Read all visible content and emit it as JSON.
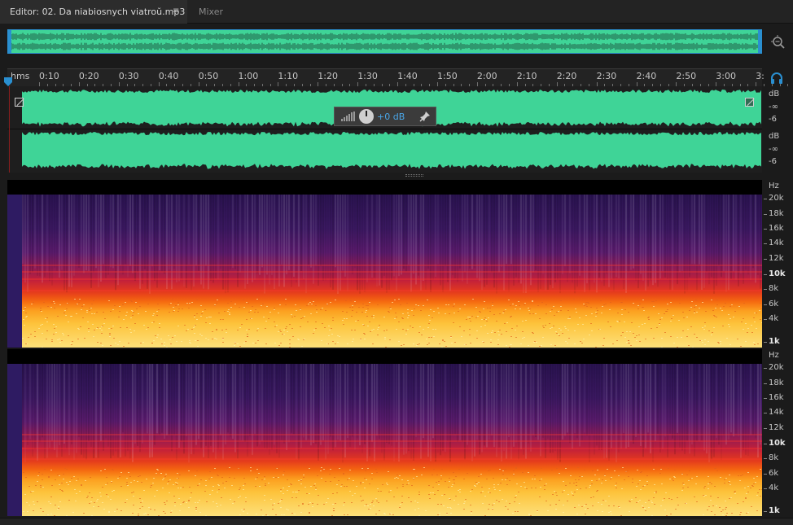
{
  "tabs": {
    "editor_label": "Editor: 02. Da niabiosnych viatroŭ.mp3",
    "menu_glyph": "≡",
    "mixer_label": "Mixer"
  },
  "ruler": {
    "unit_label": "hms",
    "ticks": [
      "0:10",
      "0:20",
      "0:30",
      "0:40",
      "0:50",
      "1:00",
      "1:10",
      "1:20",
      "1:30",
      "1:40",
      "1:50",
      "2:00",
      "2:10",
      "2:20",
      "2:30",
      "2:40",
      "2:50",
      "3:00",
      "3:"
    ]
  },
  "waveform": {
    "color": "#3fd497",
    "db_unit": "dB",
    "db_inf": "-∞",
    "db_minus6": "-6",
    "hud_value": "+0 dB"
  },
  "spectral": {
    "unit": "Hz",
    "labels": [
      "20k",
      "18k",
      "16k",
      "14k",
      "12k",
      "10k",
      "8k",
      "6k",
      "4k",
      "1k"
    ]
  },
  "icons": {
    "zoom": "zoom-icon",
    "headphones": "headphones-icon",
    "pin": "pin-icon",
    "meter": "level-meter-icon"
  },
  "colors": {
    "accent": "#2a8fd0",
    "hud_text": "#4aa6e8"
  }
}
